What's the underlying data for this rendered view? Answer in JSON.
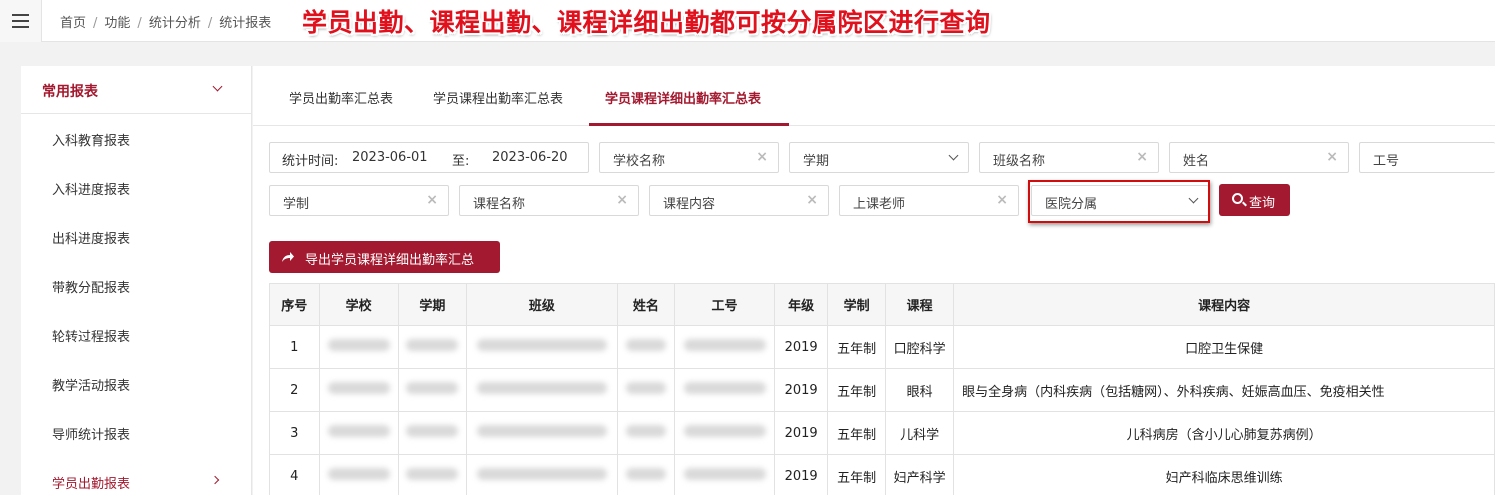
{
  "breadcrumb": [
    "首页",
    "功能",
    "统计分析",
    "统计报表"
  ],
  "annotation": "学员出勤、课程出勤、课程详细出勤都可按分属院区进行查询",
  "sidebar": {
    "header": "常用报表",
    "items": [
      {
        "label": "入科教育报表"
      },
      {
        "label": "入科进度报表"
      },
      {
        "label": "出科进度报表"
      },
      {
        "label": "带教分配报表"
      },
      {
        "label": "轮转过程报表"
      },
      {
        "label": "教学活动报表"
      },
      {
        "label": "导师统计报表"
      },
      {
        "label": "学员出勤报表"
      }
    ]
  },
  "tabs": [
    {
      "label": "学员出勤率汇总表"
    },
    {
      "label": "学员课程出勤率汇总表"
    },
    {
      "label": "学员课程详细出勤率汇总表"
    }
  ],
  "filters": {
    "date_label": "统计时间:",
    "date_from": "2023-06-01",
    "date_to_label": "至:",
    "date_to": "2023-06-20",
    "school": "学校名称",
    "term": "学期",
    "class_name": "班级名称",
    "name": "姓名",
    "job_no": "工号",
    "program": "学制",
    "course_name": "课程名称",
    "course_content": "课程内容",
    "teacher": "上课老师",
    "hospital": "医院分属",
    "clear_symbol": "×"
  },
  "buttons": {
    "search": "查询",
    "export": "导出学员课程详细出勤率汇总"
  },
  "table": {
    "headers": [
      "序号",
      "学校",
      "学期",
      "班级",
      "姓名",
      "工号",
      "年级",
      "学制",
      "课程",
      "课程内容"
    ],
    "rows": [
      {
        "no": "1",
        "grade": "2019",
        "program": "五年制",
        "course": "口腔科学",
        "content": "口腔卫生保健"
      },
      {
        "no": "2",
        "grade": "2019",
        "program": "五年制",
        "course": "眼科",
        "content": "眼与全身病（内科疾病（包括糖网）、外科疾病、妊娠高血压、免疫相关性"
      },
      {
        "no": "3",
        "grade": "2019",
        "program": "五年制",
        "course": "儿科学",
        "content": "儿科病房（含小儿心肺复苏病例）"
      },
      {
        "no": "4",
        "grade": "2019",
        "program": "五年制",
        "course": "妇产科学",
        "content": "妇产科临床思维训练"
      }
    ]
  },
  "colors": {
    "accent": "#a3192f",
    "annotation": "#e0101c",
    "highlight_border": "#d00c0c"
  }
}
